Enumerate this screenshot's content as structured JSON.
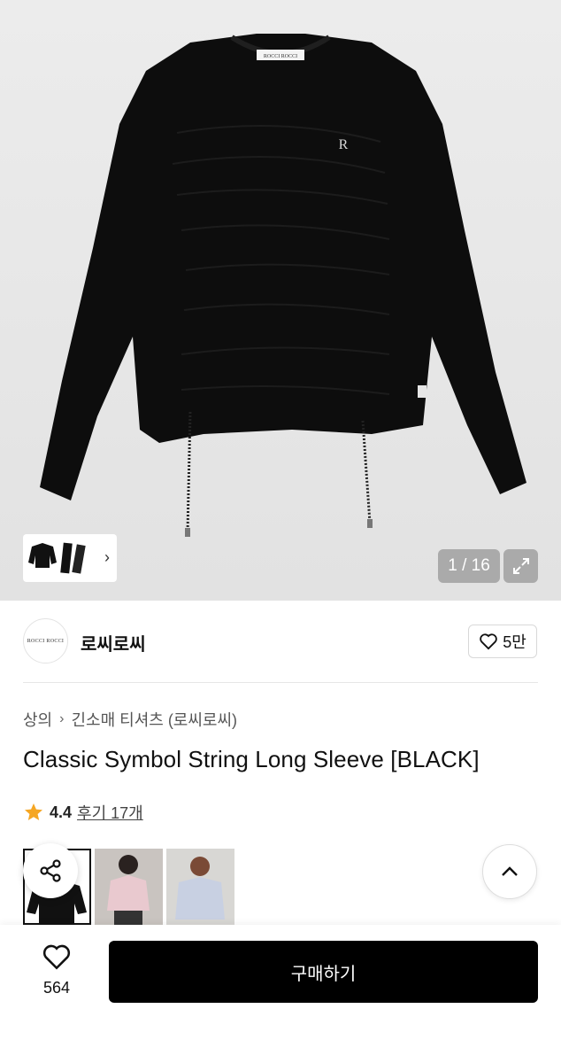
{
  "hero": {
    "garment_label": "ROCCI ROCCI",
    "counter": "1 / 16"
  },
  "brand": {
    "logo_text": "ROCCI ROCCI",
    "name": "로씨로씨",
    "likes": "5만"
  },
  "breadcrumb": {
    "category": "상의",
    "subcategory": "긴소매 티셔츠 (로씨로씨)"
  },
  "product": {
    "title": "Classic Symbol String Long Sleeve [BLACK]",
    "rating": "4.4",
    "reviews": "후기 17개"
  },
  "bottom": {
    "wish_count": "564",
    "buy_label": "구매하기"
  },
  "colors": {
    "star": "#f5a623",
    "buy_button": "#000000",
    "garment": "#0d0d0d"
  },
  "icons": [
    "chevron-right-icon",
    "expand-icon",
    "heart-outline-icon",
    "star-icon",
    "share-icon",
    "chevron-up-icon"
  ]
}
